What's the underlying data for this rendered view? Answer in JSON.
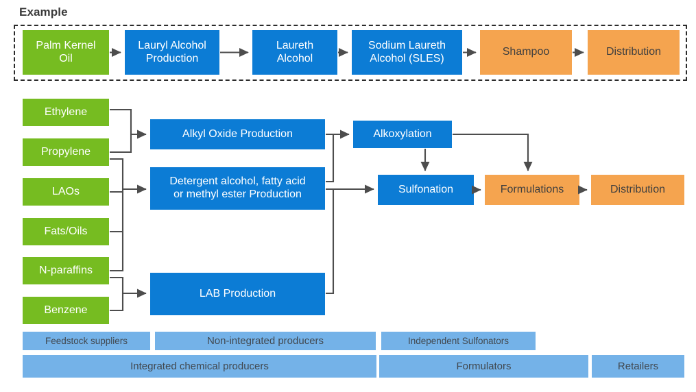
{
  "page": {
    "title": "Example",
    "colors": {
      "feedstock_green": "#76bc21",
      "process_blue": "#0c7cd5",
      "consumer_orange": "#f5a44f",
      "legend_blue": "#74b2e8",
      "connector_gray": "#4d4d4d",
      "frame_dash": "#2b2b2b"
    }
  },
  "example_chain": {
    "nodes": [
      {
        "label": "Palm Kernel Oil",
        "line1": "Palm Kernel",
        "line2": "Oil",
        "type": "feedstock"
      },
      {
        "label": "Lauryl Alcohol Production",
        "line1": "Lauryl Alcohol",
        "line2": "Production",
        "type": "process"
      },
      {
        "label": "Laureth Alcohol",
        "line1": "Laureth",
        "line2": "Alcohol",
        "type": "process"
      },
      {
        "label": "Sodium Laureth Alcohol (SLES)",
        "line1": "Sodium Laureth",
        "line2": "Alcohol (SLES)",
        "type": "process"
      },
      {
        "label": "Shampoo",
        "line1": "Shampoo",
        "line2": "",
        "type": "consumer"
      },
      {
        "label": "Distribution",
        "line1": "Distribution",
        "line2": "",
        "type": "consumer"
      }
    ]
  },
  "feedstocks": [
    {
      "label": "Ethylene"
    },
    {
      "label": "Propylene"
    },
    {
      "label": "LAOs"
    },
    {
      "label": "Fats/Oils"
    },
    {
      "label": "N-paraffins"
    },
    {
      "label": "Benzene"
    }
  ],
  "processes": {
    "alkyl_oxide": {
      "line1": "Alkyl Oxide Production",
      "line2": ""
    },
    "detergent": {
      "line1": "Detergent alcohol, fatty acid",
      "line2": "or methyl ester Production"
    },
    "lab": {
      "line1": "LAB Production",
      "line2": ""
    },
    "alkoxylation": {
      "line1": "Alkoxylation",
      "line2": ""
    },
    "sulfonation": {
      "line1": "Sulfonation",
      "line2": ""
    }
  },
  "downstream": {
    "formulations": {
      "label": "Formulations"
    },
    "distribution": {
      "label": "Distribution"
    }
  },
  "legend": {
    "row1": [
      {
        "label": "Feedstock suppliers"
      },
      {
        "label": "Non-integrated producers"
      },
      {
        "label": "Independent Sulfonators"
      }
    ],
    "row2": [
      {
        "label": "Integrated chemical producers"
      },
      {
        "label": "Formulators"
      },
      {
        "label": "Retailers"
      }
    ]
  }
}
